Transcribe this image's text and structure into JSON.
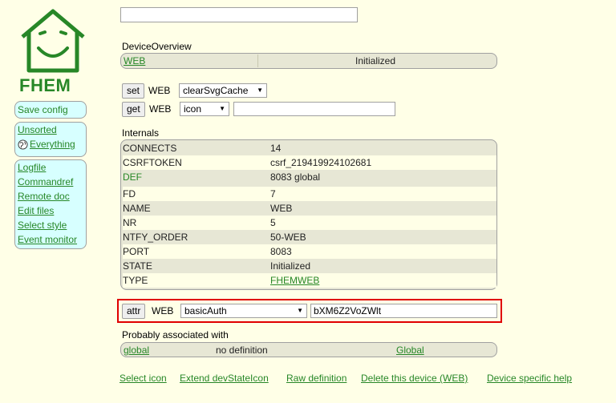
{
  "logo": {
    "brand": "FHEM"
  },
  "menu": {
    "save_config": "Save config",
    "group1": [
      "Unsorted",
      "Everything"
    ],
    "group2": [
      "Logfile",
      "Commandref",
      "Remote doc",
      "Edit files",
      "Select style",
      "Event monitor"
    ]
  },
  "top_input": {
    "value": ""
  },
  "overview": {
    "title": "DeviceOverview",
    "device": "WEB",
    "state": "Initialized"
  },
  "set_row": {
    "button": "set",
    "device": "WEB",
    "selected": "clearSvgCache"
  },
  "get_row": {
    "button": "get",
    "device": "WEB",
    "selected": "icon",
    "value": ""
  },
  "internals": {
    "title": "Internals",
    "rows": [
      {
        "k": "CONNECTS",
        "v": "14"
      },
      {
        "k": "CSRFTOKEN",
        "v": "csrf_219419924102681"
      },
      {
        "k": "DEF",
        "v": "8083 global"
      },
      {
        "k": "FD",
        "v": "7"
      },
      {
        "k": "NAME",
        "v": "WEB"
      },
      {
        "k": "NR",
        "v": "5"
      },
      {
        "k": "NTFY_ORDER",
        "v": "50-WEB"
      },
      {
        "k": "PORT",
        "v": "8083"
      },
      {
        "k": "STATE",
        "v": "Initialized"
      },
      {
        "k": "TYPE",
        "v": "FHEMWEB"
      }
    ]
  },
  "attr_row": {
    "button": "attr",
    "device": "WEB",
    "selected": "basicAuth",
    "value": "bXM6Z2VoZWlt"
  },
  "associated": {
    "title": "Probably associated with",
    "name": "global",
    "status": "no definition",
    "type": "Global"
  },
  "footer": {
    "links": [
      "Select icon",
      "Extend devStateIcon",
      "Raw definition",
      "Delete this device (WEB)",
      "Device specific help"
    ]
  },
  "colors": {
    "background": "#FFFFE7",
    "link": "#278727",
    "menu": "#D7FFFF",
    "highlight": "#E00000"
  }
}
